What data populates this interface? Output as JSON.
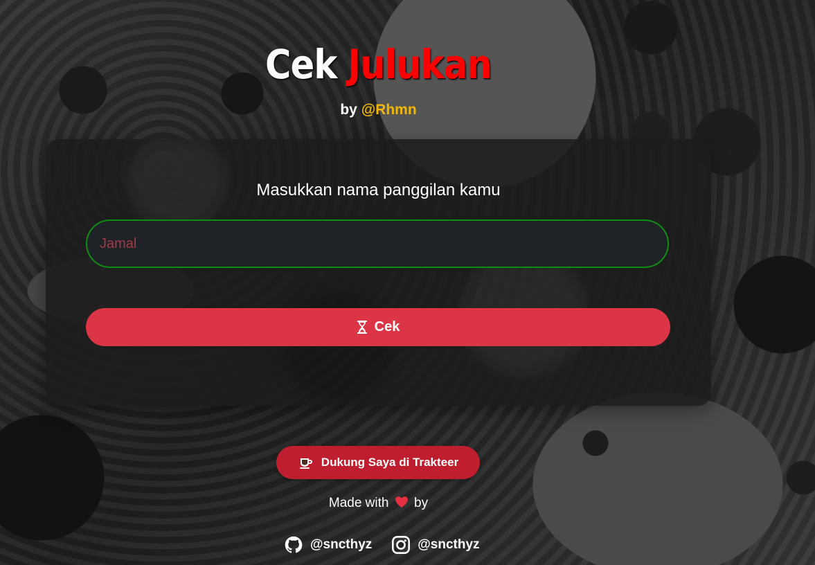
{
  "header": {
    "title_part1": "Cek",
    "title_part2": "Julukan",
    "by_text": "by",
    "author_handle": "@Rhmn"
  },
  "form": {
    "prompt": "Masukkan nama panggilan kamu",
    "input_value": "",
    "input_placeholder": "Jamal",
    "submit_label": "Cek",
    "submit_icon": "hourglass-icon"
  },
  "support": {
    "label": "Dukung Saya di Trakteer",
    "icon": "cup-icon"
  },
  "footer": {
    "made_with_text": "Made with",
    "by_text": "by",
    "heart_icon": "heart-icon",
    "socials": [
      {
        "name": "github",
        "handle": "@sncthyz",
        "icon": "github-icon"
      },
      {
        "name": "instagram",
        "handle": "@sncthyz",
        "icon": "instagram-icon"
      }
    ]
  },
  "colors": {
    "accent_red": "#dc3545",
    "title_red": "#ff0000",
    "handle_gold": "#f2b705",
    "input_border": "#0f8f12"
  }
}
